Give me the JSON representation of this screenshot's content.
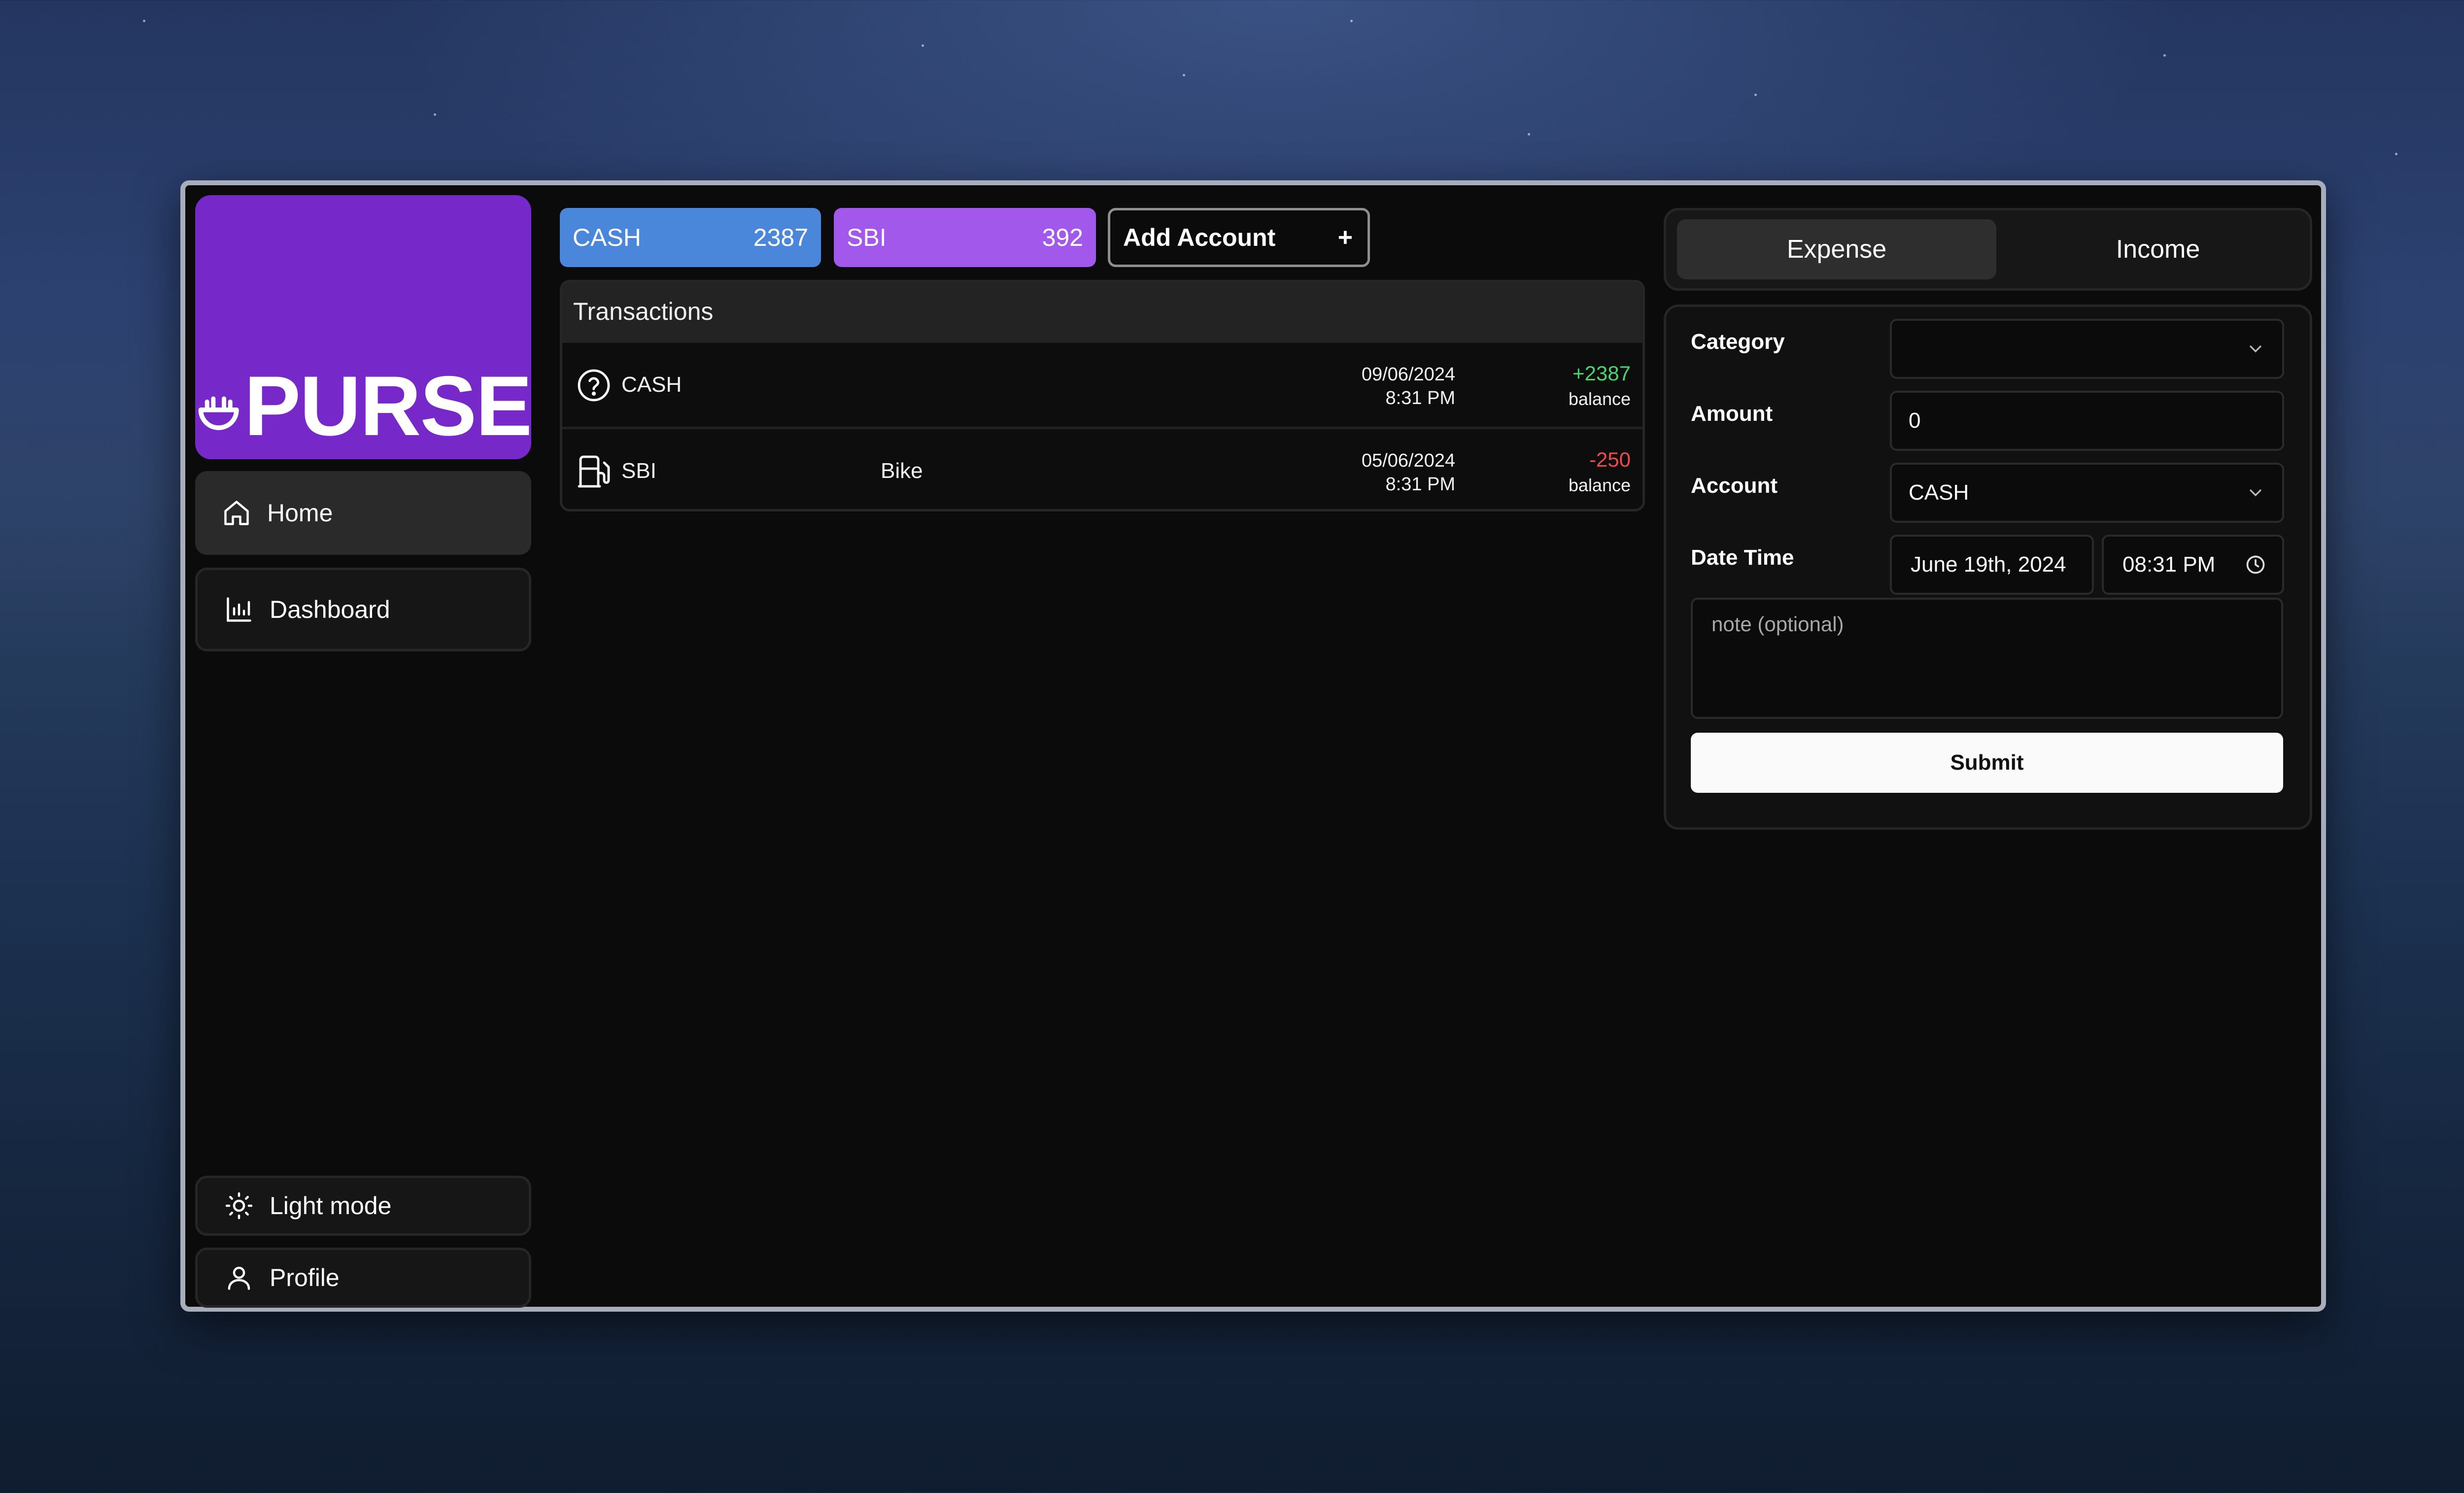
{
  "sidebar": {
    "logo_text": "PURSE",
    "items": [
      {
        "label": "Home",
        "icon": "home-icon"
      },
      {
        "label": "Dashboard",
        "icon": "bar-chart-icon"
      }
    ],
    "bottom": [
      {
        "label": "Light mode",
        "icon": "sun-icon"
      },
      {
        "label": "Profile",
        "icon": "user-icon"
      }
    ]
  },
  "accounts": [
    {
      "name": "CASH",
      "balance": "2387",
      "color": "#4a86d9"
    },
    {
      "name": "SBI",
      "balance": "392",
      "color": "#a258ea"
    }
  ],
  "add_account": {
    "label": "Add Account",
    "icon": "+"
  },
  "transactions": {
    "title": "Transactions",
    "rows": [
      {
        "icon": "question-circle-icon",
        "account": "CASH",
        "note": "",
        "date": "09/06/2024",
        "time": "8:31 PM",
        "amount": "+2387",
        "amount_label": "balance",
        "type": "positive"
      },
      {
        "icon": "fuel-pump-icon",
        "account": "SBI",
        "note": "Bike",
        "date": "05/06/2024",
        "time": "8:31 PM",
        "amount": "-250",
        "amount_label": "balance",
        "type": "negative"
      }
    ]
  },
  "tabs": {
    "expense": "Expense",
    "income": "Income",
    "active": "Expense"
  },
  "form": {
    "category_label": "Category",
    "category_value": "",
    "amount_label": "Amount",
    "amount_value": "0",
    "account_label": "Account",
    "account_value": "CASH",
    "datetime_label": "Date Time",
    "date_value": "June 19th, 2024",
    "time_value": "08:31 PM",
    "note_placeholder": "note (optional)",
    "submit_label": "Submit"
  }
}
